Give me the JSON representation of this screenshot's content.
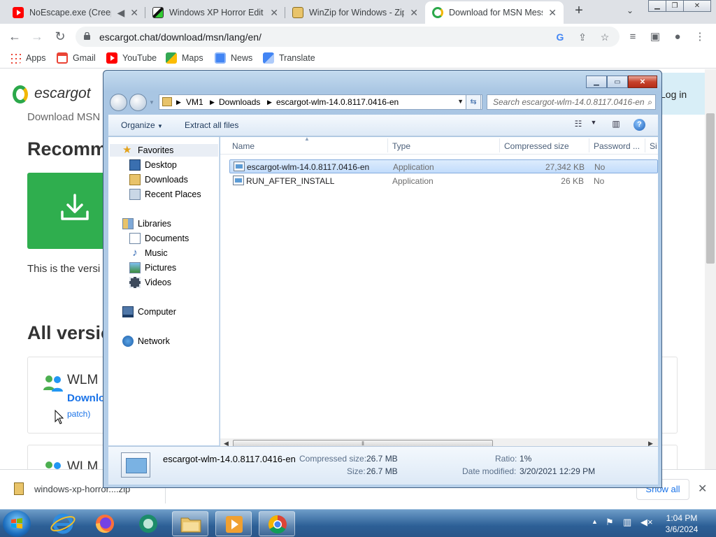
{
  "browser": {
    "tabs": [
      {
        "title": "NoEscape.exe (Creep",
        "active": false
      },
      {
        "title": "Windows XP Horror Edit",
        "active": false
      },
      {
        "title": "WinZip for Windows - Zip",
        "active": false
      },
      {
        "title": "Download for MSN Mess",
        "active": true
      }
    ],
    "address": "escargot.chat/download/msn/lang/en/",
    "bookmarks": [
      {
        "label": "Apps",
        "icon": "apps-grid-icon"
      },
      {
        "label": "Gmail",
        "icon": "gmail-icon"
      },
      {
        "label": "YouTube",
        "icon": "youtube-icon"
      },
      {
        "label": "Maps",
        "icon": "maps-icon"
      },
      {
        "label": "News",
        "icon": "news-icon"
      },
      {
        "label": "Translate",
        "icon": "translate-icon"
      }
    ]
  },
  "webpage": {
    "logo": "escargot",
    "login": "Log in",
    "subtitle": "Download MSN",
    "heading": "Recomm",
    "description": "This is the versi",
    "all_versions": "All versio",
    "cards": [
      {
        "title": "WLM",
        "link": "Downlo",
        "patch": "patch)"
      },
      {
        "title": "WLM"
      }
    ]
  },
  "download_shelf": {
    "filename": "windows-xp-horror....zip",
    "show_all": "Show all"
  },
  "explorer": {
    "breadcrumb": [
      "VM1",
      "Downloads",
      "escargot-wlm-14.0.8117.0416-en"
    ],
    "search_placeholder": "Search escargot-wlm-14.0.8117.0416-en",
    "commands": {
      "organize": "Organize",
      "extract_all": "Extract all files"
    },
    "nav": {
      "favorites": "Favorites",
      "favorites_items": [
        "Desktop",
        "Downloads",
        "Recent Places"
      ],
      "libraries": "Libraries",
      "libraries_items": [
        "Documents",
        "Music",
        "Pictures",
        "Videos"
      ],
      "computer": "Computer",
      "network": "Network"
    },
    "columns": {
      "name": "Name",
      "type": "Type",
      "compressed": "Compressed size",
      "password": "Password ...",
      "size": "Si"
    },
    "files": [
      {
        "name": "escargot-wlm-14.0.8117.0416-en",
        "type": "Application",
        "compressed": "27,342 KB",
        "password": "No",
        "selected": true
      },
      {
        "name": "RUN_AFTER_INSTALL",
        "type": "Application",
        "compressed": "26 KB",
        "password": "No",
        "selected": false
      }
    ],
    "details": {
      "name": "escargot-wlm-14.0.8117.0416-en",
      "compressed_label": "Compressed size:",
      "compressed_value": "26.7 MB",
      "size_label": "Size:",
      "size_value": "26.7 MB",
      "ratio_label": "Ratio:",
      "ratio_value": "1%",
      "modified_label": "Date modified:",
      "modified_value": "3/20/2021 12:29 PM"
    }
  },
  "taskbar": {
    "time": "1:04 PM",
    "date": "3/6/2024"
  }
}
